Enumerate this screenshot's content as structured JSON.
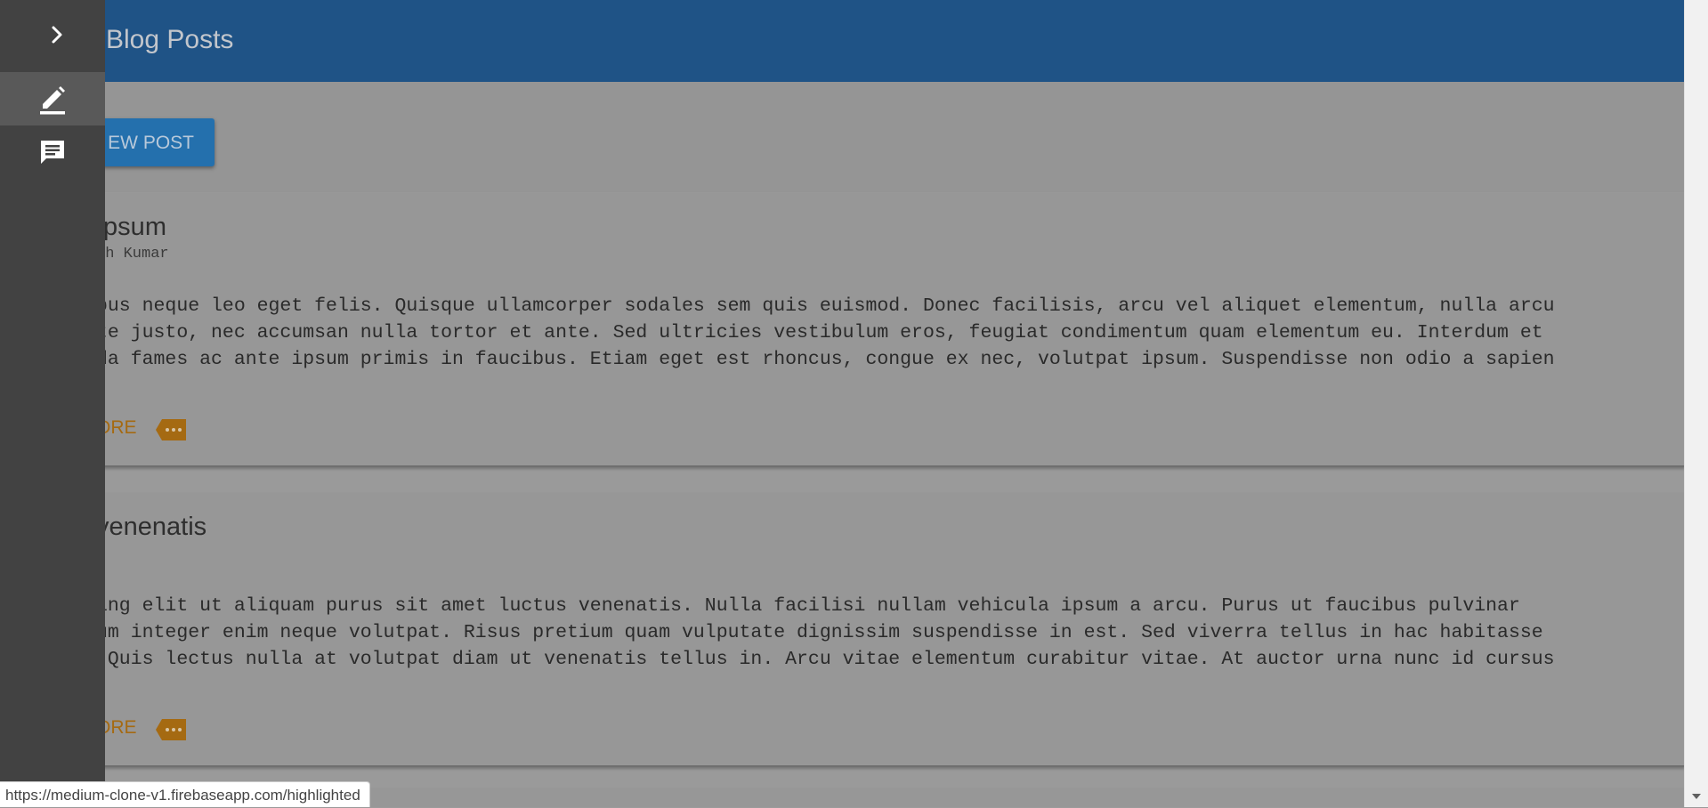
{
  "header": {
    "title": "Blog Posts"
  },
  "toolbar": {
    "new_post_label": "EW POST"
  },
  "posts": [
    {
      "title": "Ipsum",
      "author": "th Kumar",
      "excerpt_lines": [
        "bus neque leo eget felis. Quisque ullamcorper sodales sem quis euismod. Donec facilisis, arcu vel aliquet elementum, nulla arcu",
        "te justo, nec accumsan nulla tortor et ante. Sed ultricies vestibulum eros, feugiat condimentum quam elementum eu. Interdum et",
        "da fames ac ante ipsum primis in faucibus. Etiam eget est rhoncus, congue ex nec, volutpat ipsum. Suspendisse non odio a sapien"
      ],
      "read_more_label": "ORE"
    },
    {
      "title": "venenatis",
      "author": "",
      "excerpt_lines": [
        "ing elit ut aliquam purus sit amet luctus venenatis. Nulla facilisi nullam vehicula ipsum a arcu. Purus ut faucibus pulvinar",
        "um integer enim neque volutpat. Risus pretium quam vulputate dignissim suspendisse in est. Sed viverra tellus in hac habitasse",
        " Quis lectus nulla at volutpat diam ut venenatis tellus in. Arcu vitae elementum curabitur vitae. At auctor urna nunc id cursus"
      ],
      "read_more_label": "ORE"
    }
  ],
  "drawer": {
    "toggle_icon": "chevron-right-icon",
    "items": [
      {
        "icon": "edit-icon",
        "active": true
      },
      {
        "icon": "comment-icon",
        "active": false
      }
    ]
  },
  "status_bar": {
    "url": "https://medium-clone-v1.firebaseapp.com/highlighted"
  },
  "colors": {
    "app_bar": "#1f5386",
    "drawer": "#424242",
    "accent": "#a56a12",
    "button": "#2470ad"
  }
}
